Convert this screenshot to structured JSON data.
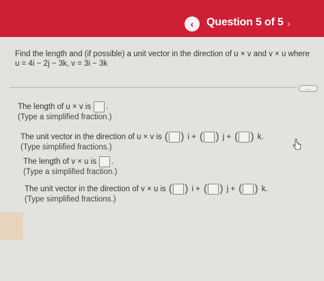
{
  "header": {
    "title": "Question 5 of 5",
    "prev_icon": "chevron-left",
    "next_icon": "chevron-right"
  },
  "problem": {
    "line1": "Find the length and (if possible) a unit vector in the direction of u × v and  v × u where",
    "line2": "u = 4i − 2j − 3k,   v = 3i − 3k"
  },
  "more_button": "...",
  "parts": [
    {
      "prompt": "The length of u × v is",
      "hint": "(Type a simplified fraction.)"
    },
    {
      "prompt": "The unit vector in the direction of u × v is",
      "hint": "(Type simplified fractions.)",
      "units": [
        "i +",
        "j +",
        "k."
      ]
    },
    {
      "prompt": "The length of v × u is",
      "hint": "(Type a simplified fraction.)"
    },
    {
      "prompt": "The unit vector in the direction of v × u is",
      "hint": "(Type simplified fractions.)",
      "units": [
        "i +",
        "j +",
        "k."
      ]
    }
  ]
}
